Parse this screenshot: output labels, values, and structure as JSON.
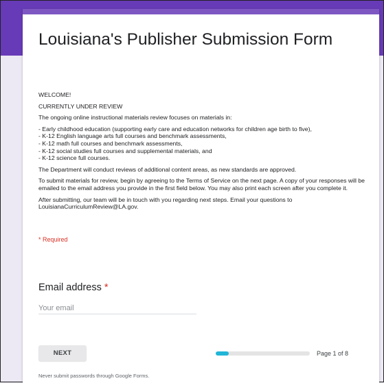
{
  "form": {
    "title": "Louisiana's Publisher Submission Form",
    "welcome": "WELCOME!",
    "review_status": "CURRENTLY UNDER REVIEW",
    "intro": "The ongoing online instructional materials review focuses on materials in:",
    "bullets": [
      "- Early childhood education (supporting early care and education networks for children age birth to five),",
      "- K-12 English language arts full courses and benchmark assessments,",
      "- K-12 math full courses and benchmark assessments,",
      "- K-12 social studies full courses and supplemental materials, and",
      "- K-12 science full courses."
    ],
    "paragraph_standards": "The Department will conduct reviews of additional content areas, as new standards are approved.",
    "paragraph_submit": "To submit materials for review, begin by agreeing to the Terms of Service on the next page. A copy of your responses will be emailed to the email address you provide in the first field below. You may also print each screen after you complete it.",
    "paragraph_contact": "After submitting, our team will be in touch with you regarding next steps. Email your questions to LouisianaCurriculumReview@LA.gov.",
    "required_note": "* Required"
  },
  "email_question": {
    "label": "Email address",
    "required_marker": "*",
    "placeholder": "Your email",
    "value": ""
  },
  "navigation": {
    "next_label": "NEXT",
    "page_indicator": "Page 1 of 8",
    "progress_fraction": 0.125
  },
  "footer": {
    "note": "Never submit passwords through Google Forms."
  },
  "colors": {
    "header_purple": "#673ab7",
    "accent_bar": "#7e57c2",
    "required_red": "#d93025",
    "progress_fill": "#21b6d7"
  }
}
